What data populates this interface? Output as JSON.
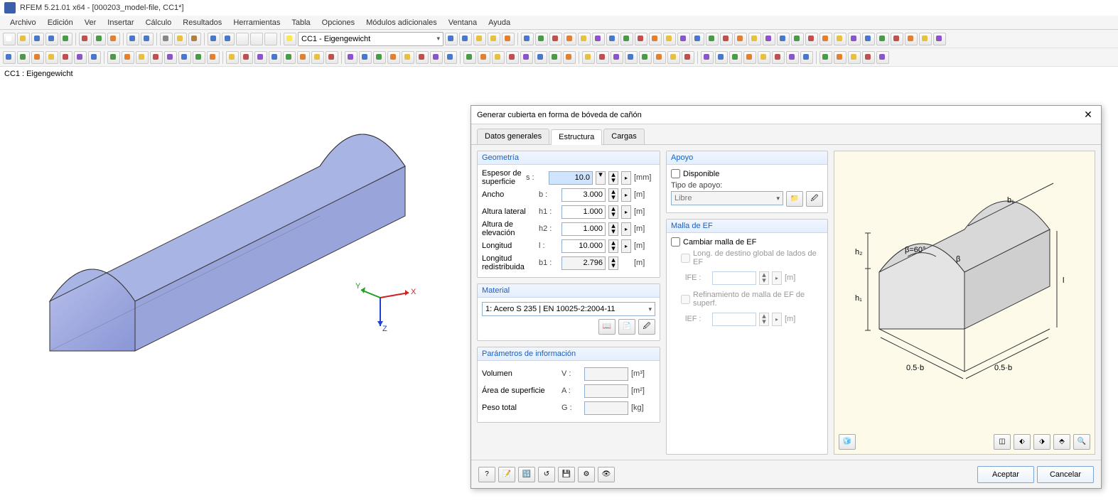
{
  "window": {
    "title": "RFEM 5.21.01 x64 - [000203_model-file, CC1*]"
  },
  "menu": [
    "Archivo",
    "Edición",
    "Ver",
    "Insertar",
    "Cálculo",
    "Resultados",
    "Herramientas",
    "Tabla",
    "Opciones",
    "Módulos adicionales",
    "Ventana",
    "Ayuda"
  ],
  "combo": {
    "value": "CC1 - Eigengewicht"
  },
  "viewport": {
    "label": "CC1 : Eigengewicht",
    "axes": {
      "x": "X",
      "y": "Y",
      "z": "Z"
    }
  },
  "dialog": {
    "title": "Generar cubierta en forma de bóveda de cañón",
    "tabs": [
      "Datos generales",
      "Estructura",
      "Cargas"
    ],
    "active_tab": "Estructura",
    "groups": {
      "geometria": {
        "title": "Geometría",
        "rows": [
          {
            "label": "Espesor de superficie",
            "sym": "s :",
            "value": "10.0",
            "unit": "[mm]",
            "sel": true,
            "pick": true
          },
          {
            "label": "Ancho",
            "sym": "b :",
            "value": "3.000",
            "unit": "[m]",
            "pick": true
          },
          {
            "label": "Altura lateral",
            "sym": "h1 :",
            "value": "1.000",
            "unit": "[m]",
            "pick": true
          },
          {
            "label": "Altura de elevación",
            "sym": "h2 :",
            "value": "1.000",
            "unit": "[m]",
            "pick": true
          },
          {
            "label": "Longitud",
            "sym": "l :",
            "value": "10.000",
            "unit": "[m]",
            "pick": true
          },
          {
            "label": "Longitud redistribuida",
            "sym": "b1 :",
            "value": "2.796",
            "unit": "[m]",
            "readonly": true
          }
        ]
      },
      "material": {
        "title": "Material",
        "value": "1: Acero S 235 | EN 10025-2:2004-11"
      },
      "info": {
        "title": "Parámetros de información",
        "rows": [
          {
            "label": "Volumen",
            "sym": "V :",
            "unit": "[m³]"
          },
          {
            "label": "Área de superficie",
            "sym": "A :",
            "unit": "[m²]"
          },
          {
            "label": "Peso total",
            "sym": "G :",
            "unit": "[kg]"
          }
        ]
      },
      "apoyo": {
        "title": "Apoyo",
        "disponible": "Disponible",
        "tipo_label": "Tipo de apoyo:",
        "tipo_value": "Libre"
      },
      "malla": {
        "title": "Malla de EF",
        "cambiar": "Cambiar malla de EF",
        "long": "Long. de destino global de lados de EF",
        "refin": "Refinamiento de malla de EF de superf.",
        "lfe_sym": "lFE :",
        "lfe_unit": "[m]",
        "lef_sym": "lEF :",
        "lef_unit": "[m]"
      }
    },
    "buttons": {
      "ok": "Aceptar",
      "cancel": "Cancelar"
    },
    "diagram": {
      "b1": "b₁",
      "h2": "h₂",
      "h1": "h₁",
      "beta": "β=60°",
      "beta2": "β",
      "l": "l",
      "half_b_l": "0.5·b",
      "half_b_r": "0.5·b"
    }
  },
  "chart_data": {
    "type": "table",
    "title": "Geometría de cubierta de bóveda de cañón",
    "series": [
      {
        "name": "s",
        "value": 10.0,
        "unit": "mm"
      },
      {
        "name": "b",
        "value": 3.0,
        "unit": "m"
      },
      {
        "name": "h1",
        "value": 1.0,
        "unit": "m"
      },
      {
        "name": "h2",
        "value": 1.0,
        "unit": "m"
      },
      {
        "name": "l",
        "value": 10.0,
        "unit": "m"
      },
      {
        "name": "b1",
        "value": 2.796,
        "unit": "m"
      },
      {
        "name": "β",
        "value": 60,
        "unit": "°"
      }
    ]
  }
}
